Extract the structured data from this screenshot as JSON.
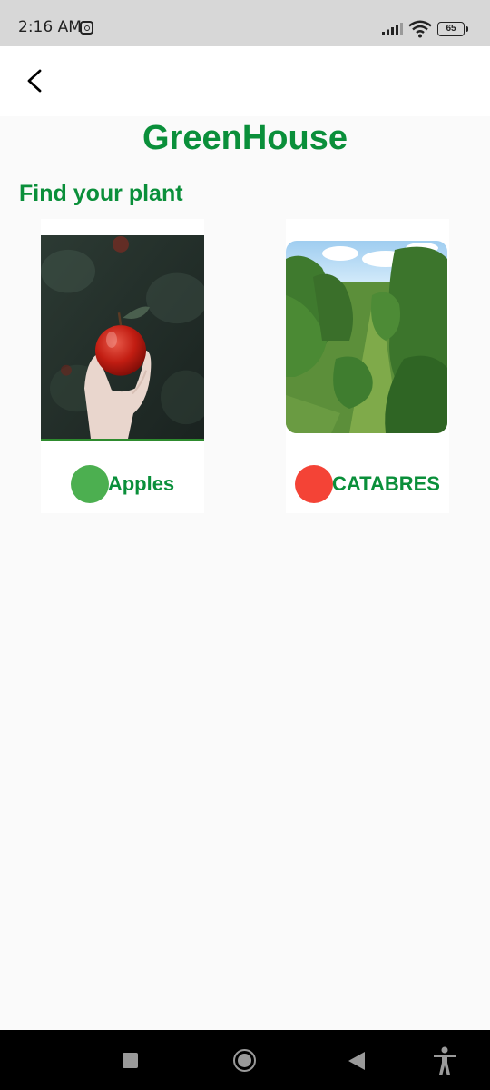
{
  "status_bar": {
    "time": "2:16 AM",
    "battery_level": "65",
    "icons": [
      "instagram-icon",
      "signal-icon",
      "wifi-icon",
      "battery-icon"
    ]
  },
  "app_bar": {
    "back_icon": "chevron-left-icon"
  },
  "header": {
    "title": "GreenHouse",
    "subtitle": "Find your plant"
  },
  "plants": [
    {
      "name": "Apples",
      "status_color": "#4caf50",
      "image": "apple-in-hand-photo"
    },
    {
      "name": "CATABRES",
      "status_color": "#f44336",
      "image": "orchard-rows-photo"
    }
  ],
  "nav_bar": {
    "icons": [
      "recents-icon",
      "home-icon",
      "back-icon",
      "accessibility-icon"
    ]
  },
  "colors": {
    "brand_green": "#0a8f3a",
    "background": "#fafafa",
    "status_ok": "#4caf50",
    "status_bad": "#f44336"
  }
}
